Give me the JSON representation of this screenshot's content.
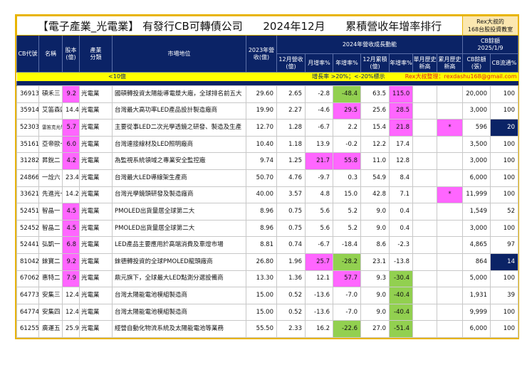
{
  "title": {
    "main": "【電子產業_光電業】 有發行CB可轉債公司",
    "period": "2024年12月",
    "subject": "累積營收年增率排行",
    "brand_line1": "Rex大叔的",
    "brand_line2": "168台股投資教室"
  },
  "header": {
    "code": "CB代號",
    "name": "名稱",
    "capital": "股本(億)",
    "industry": "產業分類",
    "position": "市場地位",
    "rev2023": "2023年營收(億)",
    "group2024": "2024年營收成長動能",
    "cb_group": "CB餘額",
    "cb_date": "2025/1/9",
    "dec_rev": "12月營收(億)",
    "mom": "月增率%",
    "yoy": "年增率%",
    "dec_cum": "12月累積(億)",
    "cum_yoy": "年增率%",
    "month_high": "單月歷史新高",
    "cum_high": "累月歷史新高",
    "cb_balance": "CB餘額(張)",
    "cb_float": "CB流通%"
  },
  "legend": {
    "capital_note": "<10億",
    "growth_note": "增長率 >20%；<-20%標示",
    "author": "Rex大叔整理：rexdashu168@gmail.com"
  },
  "colors": {
    "navy": "#0b2366",
    "pink": "#ff66ff",
    "green": "#92d050",
    "yellow": "#ffff00",
    "border": "#e8b400"
  },
  "rows": [
    {
      "v": [
        "36913",
        "碩禾三",
        "9.2",
        "光電業",
        "國碩轉投資太陽能導電漿大廠，全球排名前五大",
        "29.60",
        "2.65",
        "-2.8",
        "-48.4",
        "63.5",
        "115.0",
        "",
        "",
        "20,000",
        "100"
      ],
      "m": {
        "2": "p",
        "8": "g",
        "10": "p"
      }
    },
    {
      "v": [
        "35914",
        "艾笛森四",
        "14.4",
        "光電業",
        "台灣最大高功率LED產品設計製造廠商",
        "19.90",
        "2.27",
        "-4.6",
        "29.5",
        "25.6",
        "28.5",
        "",
        "",
        "3,000",
        "100"
      ],
      "m": {
        "8": "p",
        "10": "p"
      }
    },
    {
      "v": [
        "52303",
        "雷笛克光學三",
        "5.7",
        "光電業",
        "主要從事LED二次光學透鏡之研發、製造及生產",
        "12.70",
        "1.28",
        "-6.7",
        "2.2",
        "15.4",
        "21.8",
        "",
        "*",
        "596",
        "20"
      ],
      "m": {
        "2": "p",
        "10": "p",
        "12": "p",
        "14": "n"
      }
    },
    {
      "v": [
        "35161",
        "亞帝歐一",
        "6.0",
        "光電業",
        "台灣連接線材及LED照明廠商",
        "10.40",
        "1.18",
        "13.9",
        "-0.2",
        "12.2",
        "17.4",
        "",
        "",
        "3,500",
        "100"
      ],
      "m": {
        "2": "p"
      }
    },
    {
      "v": [
        "31282",
        "昇銳二",
        "4.2",
        "光電業",
        "為監視系統領域之專業安全監控廠",
        "9.74",
        "1.25",
        "21.7",
        "55.8",
        "11.0",
        "12.8",
        "",
        "",
        "3,000",
        "100"
      ],
      "m": {
        "2": "p",
        "7": "p",
        "8": "p"
      }
    },
    {
      "v": [
        "24866",
        "一詮六",
        "23.4",
        "光電業",
        "台灣最大LED導線架生產商",
        "50.70",
        "4.76",
        "-9.7",
        "0.3",
        "54.9",
        "8.4",
        "",
        "",
        "6,000",
        "100"
      ],
      "m": {}
    },
    {
      "v": [
        "33621",
        "先進光一",
        "14.2",
        "光電業",
        "台灣光學鏡頭研發及製造廠商",
        "40.00",
        "3.57",
        "4.8",
        "15.0",
        "42.8",
        "7.1",
        "",
        "*",
        "11,999",
        "100"
      ],
      "m": {
        "12": "p"
      }
    },
    {
      "v": [
        "52451",
        "智晶一",
        "4.5",
        "光電業",
        "PMOLED出貨量居全球第二大",
        "8.96",
        "0.75",
        "5.6",
        "5.2",
        "9.0",
        "0.4",
        "",
        "",
        "1,549",
        "52"
      ],
      "m": {
        "2": "p"
      }
    },
    {
      "v": [
        "52452",
        "智晶二",
        "4.5",
        "光電業",
        "PMOLED出貨量居全球第二大",
        "8.96",
        "0.75",
        "5.6",
        "5.2",
        "9.0",
        "0.4",
        "",
        "",
        "3,000",
        "100"
      ],
      "m": {
        "2": "p"
      }
    },
    {
      "v": [
        "52441",
        "弘凱一",
        "6.8",
        "光電業",
        "LED產品主要應用於高端消費及車燈市場",
        "8.81",
        "0.74",
        "-6.7",
        "-18.4",
        "8.6",
        "-2.3",
        "",
        "",
        "4,865",
        "97"
      ],
      "m": {
        "2": "p"
      }
    },
    {
      "v": [
        "81042",
        "錸寶二",
        "9.2",
        "光電業",
        "錸德轉投資的全球PMOLED龍頭廠商",
        "26.80",
        "1.96",
        "25.7",
        "-28.2",
        "23.1",
        "-13.8",
        "",
        "",
        "864",
        "14"
      ],
      "m": {
        "2": "p",
        "7": "p",
        "8": "g",
        "14": "n"
      }
    },
    {
      "v": [
        "67062",
        "惠特二",
        "7.9",
        "光電業",
        "鼎元旗下，全球最大LED點測分選設備商",
        "13.30",
        "1.36",
        "12.1",
        "57.7",
        "9.3",
        "-30.4",
        "",
        "",
        "5,000",
        "100"
      ],
      "m": {
        "2": "p",
        "8": "p",
        "10": "g"
      }
    },
    {
      "v": [
        "64773",
        "安集三",
        "12.4",
        "光電業",
        "台灣太陽能電池模組製造商",
        "15.00",
        "0.52",
        "-13.6",
        "-7.0",
        "9.0",
        "-40.4",
        "",
        "",
        "1,931",
        "39"
      ],
      "m": {
        "10": "g"
      }
    },
    {
      "v": [
        "64774",
        "安集四",
        "12.4",
        "光電業",
        "台灣太陽能電池模組製造商",
        "15.00",
        "0.52",
        "-13.6",
        "-7.0",
        "9.0",
        "-40.4",
        "",
        "",
        "9,999",
        "100"
      ],
      "m": {
        "10": "g"
      }
    },
    {
      "v": [
        "61255",
        "廣運五",
        "25.9",
        "光電業",
        "經營自動化物流系統及太陽能電池等業務",
        "55.50",
        "2.33",
        "16.2",
        "-22.6",
        "27.0",
        "-51.4",
        "",
        "",
        "6,000",
        "100"
      ],
      "m": {
        "8": "g",
        "10": "g"
      }
    }
  ]
}
